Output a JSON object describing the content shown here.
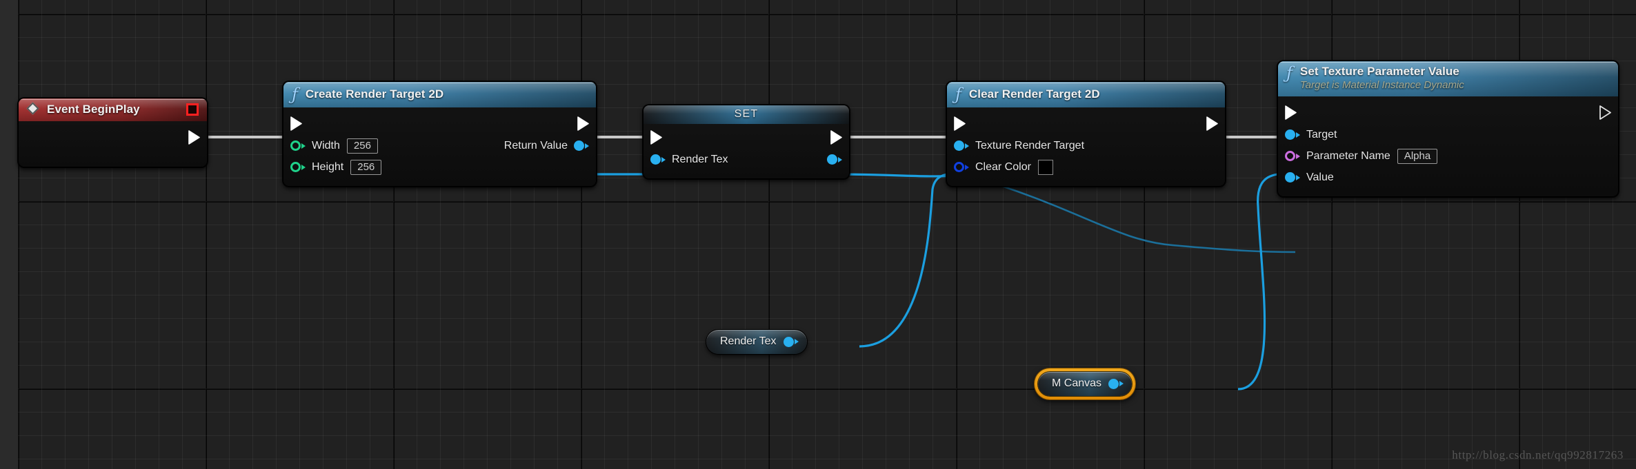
{
  "graph": {
    "app": "Unreal Engine Blueprint Event Graph",
    "watermark": "http://blog.csdn.net/qq992817263"
  },
  "colors": {
    "exec_white": "#ffffff",
    "object_blue": "#29b0f0",
    "int_green": "#1fd18a",
    "name_magenta": "#cc6ee0",
    "linearcolor_blue": "#1040e0",
    "event_red": "#a02c2c",
    "function_blue": "#3d85ad",
    "selection_orange": "#f0a81e",
    "clear_color_value": "#000000"
  },
  "nodes": {
    "event_begin_play": {
      "title": "Event BeginPlay",
      "icon": "event-diamond-icon",
      "delegate_pin": "delegate-output-pin",
      "exec_out": "exec-output-pin"
    },
    "create_render_target": {
      "title": "Create Render Target 2D",
      "icon": "function-fx-icon",
      "inputs": [
        {
          "label": "Width",
          "value": "256",
          "pin_type": "int"
        },
        {
          "label": "Height",
          "value": "256",
          "pin_type": "int"
        }
      ],
      "outputs": [
        {
          "label": "Return Value",
          "pin_type": "object"
        }
      ]
    },
    "set_node": {
      "title": "SET",
      "inputs": [
        {
          "label": "Render Tex",
          "pin_type": "object"
        }
      ],
      "outputs": [
        {
          "label": "",
          "pin_type": "object"
        }
      ]
    },
    "clear_render_target": {
      "title": "Clear Render Target 2D",
      "icon": "function-fx-icon",
      "inputs": [
        {
          "label": "Texture Render Target",
          "pin_type": "object"
        },
        {
          "label": "Clear Color",
          "pin_type": "linearcolor",
          "swatch": "#000000"
        }
      ]
    },
    "set_texture_parameter_value": {
      "title": "Set Texture Parameter Value",
      "subtitle": "Target is Material Instance Dynamic",
      "icon": "function-fx-icon",
      "inputs": [
        {
          "label": "Target",
          "pin_type": "object"
        },
        {
          "label": "Parameter Name",
          "value": "Alpha",
          "pin_type": "name"
        },
        {
          "label": "Value",
          "pin_type": "object"
        }
      ]
    },
    "getter_render_tex": {
      "label": "Render Tex",
      "pin_type": "object",
      "selected": false
    },
    "getter_m_canvas": {
      "label": "M Canvas",
      "pin_type": "object",
      "selected": true
    }
  }
}
